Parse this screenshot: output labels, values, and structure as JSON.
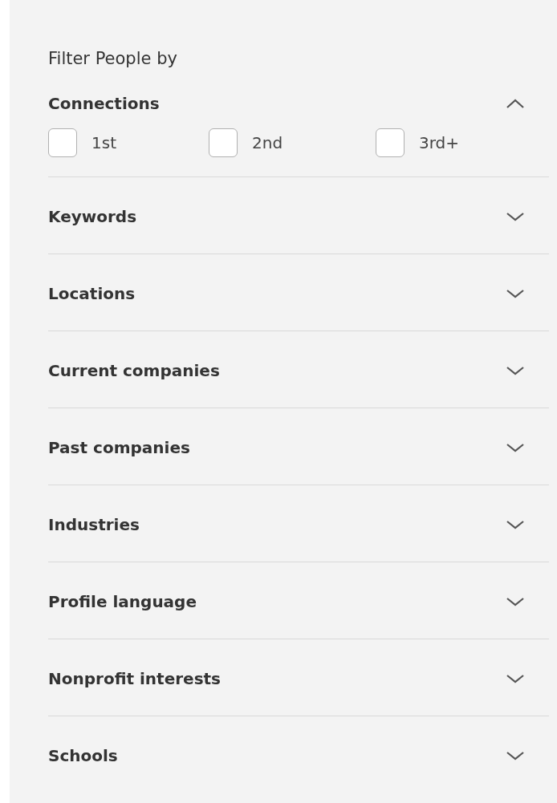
{
  "title": "Filter People by",
  "sections": [
    {
      "label": "Connections",
      "expanded": true,
      "options": [
        {
          "label": "1st",
          "checked": false
        },
        {
          "label": "2nd",
          "checked": false
        },
        {
          "label": "3rd+",
          "checked": false
        }
      ]
    },
    {
      "label": "Keywords",
      "expanded": false
    },
    {
      "label": "Locations",
      "expanded": false
    },
    {
      "label": "Current companies",
      "expanded": false
    },
    {
      "label": "Past companies",
      "expanded": false
    },
    {
      "label": "Industries",
      "expanded": false
    },
    {
      "label": "Profile language",
      "expanded": false
    },
    {
      "label": "Nonprofit interests",
      "expanded": false
    },
    {
      "label": "Schools",
      "expanded": false
    }
  ]
}
